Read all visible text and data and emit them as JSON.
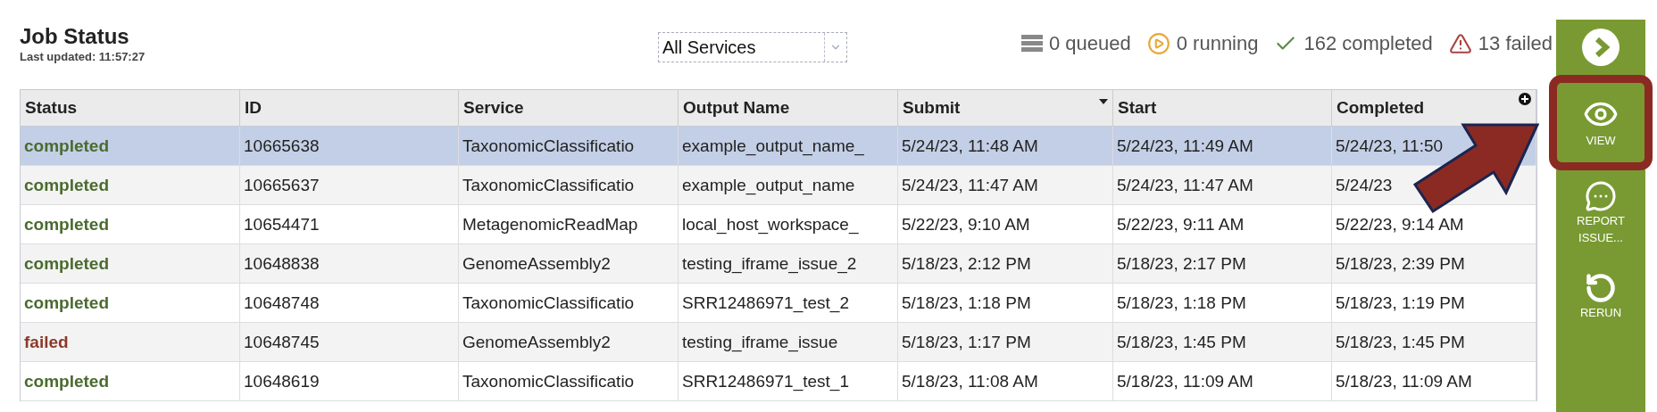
{
  "header": {
    "title": "Job Status",
    "last_updated": "Last updated: 11:57:27"
  },
  "filter": {
    "value": "All Services"
  },
  "counts": [
    {
      "kind": "queued",
      "label": "0 queued"
    },
    {
      "kind": "running",
      "label": "0 running"
    },
    {
      "kind": "completed",
      "label": "162 completed"
    },
    {
      "kind": "failed",
      "label": "13 failed"
    }
  ],
  "table": {
    "columns": [
      {
        "label": "Status",
        "sorted": false
      },
      {
        "label": "ID",
        "sorted": false
      },
      {
        "label": "Service",
        "sorted": false
      },
      {
        "label": "Output Name",
        "sorted": false
      },
      {
        "label": "Submit",
        "sorted": true
      },
      {
        "label": "Start",
        "sorted": false
      },
      {
        "label": "Completed",
        "sorted": false
      }
    ],
    "rows": [
      {
        "selected": true,
        "color": "#4a6b2e",
        "cells": [
          "completed",
          "10665638",
          "TaxonomicClassificatio",
          "example_output_name_",
          "5/24/23, 11:48 AM",
          "5/24/23, 11:49 AM",
          "5/24/23, 11:50"
        ]
      },
      {
        "selected": false,
        "color": "#4a6b2e",
        "cells": [
          "completed",
          "10665637",
          "TaxonomicClassificatio",
          "example_output_name",
          "5/24/23, 11:47 AM",
          "5/24/23, 11:47 AM",
          "5/24/23"
        ]
      },
      {
        "selected": false,
        "color": "#4a6b2e",
        "cells": [
          "completed",
          "10654471",
          "MetagenomicReadMap",
          "local_host_workspace_",
          "5/22/23, 9:10 AM",
          "5/22/23, 9:11 AM",
          "5/22/23, 9:14 AM"
        ]
      },
      {
        "selected": false,
        "color": "#4a6b2e",
        "cells": [
          "completed",
          "10648838",
          "GenomeAssembly2",
          "testing_iframe_issue_2",
          "5/18/23, 2:12 PM",
          "5/18/23, 2:17 PM",
          "5/18/23, 2:39 PM"
        ]
      },
      {
        "selected": false,
        "color": "#4a6b2e",
        "cells": [
          "completed",
          "10648748",
          "TaxonomicClassificatio",
          "SRR12486971_test_2",
          "5/18/23, 1:18 PM",
          "5/18/23, 1:18 PM",
          "5/18/23, 1:19 PM"
        ]
      },
      {
        "selected": false,
        "color": "#8b3a2a",
        "cells": [
          "failed",
          "10648745",
          "GenomeAssembly2",
          "testing_iframe_issue",
          "5/18/23, 1:17 PM",
          "5/18/23, 1:45 PM",
          "5/18/23, 1:45 PM"
        ]
      },
      {
        "selected": false,
        "color": "#4a6b2e",
        "cells": [
          "completed",
          "10648619",
          "TaxonomicClassificatio",
          "SRR12486971_test_1",
          "5/18/23, 11:08 AM",
          "5/18/23, 11:09 AM",
          "5/18/23, 11:09 AM"
        ]
      }
    ]
  },
  "sidebar": {
    "buttons": [
      {
        "kind": "toggle",
        "highlighted": false
      },
      {
        "kind": "view",
        "label": "VIEW",
        "highlighted": true
      },
      {
        "kind": "report",
        "label": "REPORT ISSUE...",
        "highlighted": false
      },
      {
        "kind": "rerun",
        "label": "RERUN",
        "highlighted": false
      }
    ]
  },
  "annotation": {
    "kind": "arrow"
  }
}
